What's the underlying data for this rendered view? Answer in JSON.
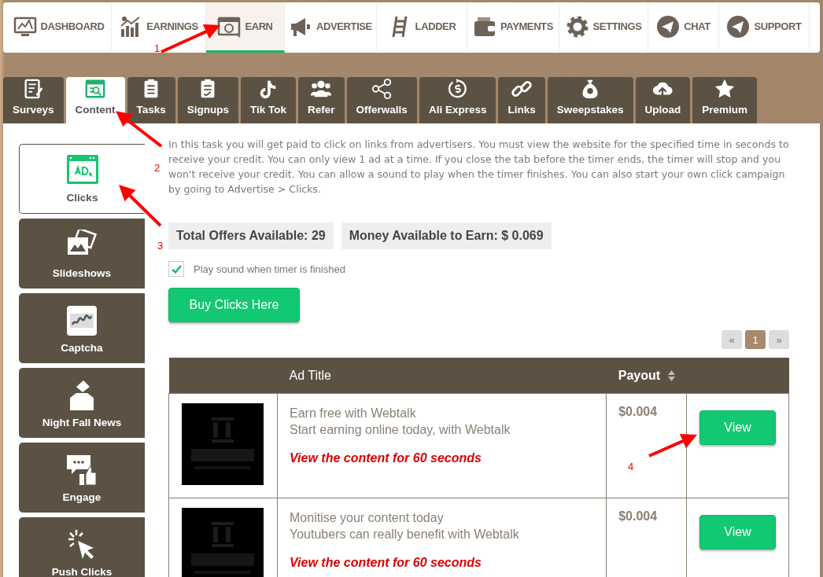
{
  "nav": [
    {
      "label": "DASHBOARD",
      "kind": "dashboard",
      "selected": false
    },
    {
      "label": "EARNINGS",
      "kind": "earnings",
      "selected": false
    },
    {
      "label": "EARN",
      "kind": "earn",
      "selected": true
    },
    {
      "label": "ADVERTISE",
      "kind": "advertise",
      "selected": false
    },
    {
      "label": "LADDER",
      "kind": "ladder",
      "selected": false
    },
    {
      "label": "PAYMENTS",
      "kind": "payments",
      "selected": false
    },
    {
      "label": "SETTINGS",
      "kind": "settings",
      "selected": false
    },
    {
      "label": "CHAT",
      "kind": "chat",
      "selected": false
    },
    {
      "label": "SUPPORT",
      "kind": "support",
      "selected": false
    }
  ],
  "tabs": [
    {
      "label": "Surveys",
      "kind": "surveys",
      "selected": false
    },
    {
      "label": "Content",
      "kind": "content",
      "selected": true
    },
    {
      "label": "Tasks",
      "kind": "tasks",
      "selected": false
    },
    {
      "label": "Signups",
      "kind": "signups",
      "selected": false
    },
    {
      "label": "Tik Tok",
      "kind": "tiktok",
      "selected": false
    },
    {
      "label": "Refer",
      "kind": "refer",
      "selected": false
    },
    {
      "label": "Offerwalls",
      "kind": "offerwalls",
      "selected": false
    },
    {
      "label": "Ali Express",
      "kind": "aliexpress",
      "selected": false
    },
    {
      "label": "Links",
      "kind": "links",
      "selected": false
    },
    {
      "label": "Sweepstakes",
      "kind": "sweepstakes",
      "selected": false
    },
    {
      "label": "Upload",
      "kind": "upload",
      "selected": false
    },
    {
      "label": "Premium",
      "kind": "premium",
      "selected": false
    }
  ],
  "sidebar": {
    "items": [
      {
        "label": "Clicks",
        "kind": "clicks",
        "selected": true
      },
      {
        "label": "Slideshows",
        "kind": "slideshows",
        "selected": false
      },
      {
        "label": "Captcha",
        "kind": "captcha",
        "selected": false
      },
      {
        "label": "Night Fall News",
        "kind": "news",
        "selected": false
      },
      {
        "label": "Engage",
        "kind": "engage",
        "selected": false
      },
      {
        "label": "Push Clicks",
        "kind": "push",
        "selected": false
      }
    ]
  },
  "intro": "In this task you will get paid to click on links from advertisers. You must view the website for the specified time in seconds to receive your credit. You can only view 1 ad at a time. If you close the tab before the timer ends, the timer will stop and you won't receive your credit. You can allow a sound to play when the timer finishes. You can also start your own click campaign by going to Advertise > Clicks.",
  "stats": [
    "Total Offers Available: 29",
    "Money Available to Earn: $ 0.069"
  ],
  "sound_option": {
    "label": "Play sound when timer is finished",
    "checked": true
  },
  "buy_button": "Buy Clicks Here",
  "pagination": [
    {
      "label": "«",
      "selected": false
    },
    {
      "label": "1",
      "selected": true
    },
    {
      "label": "»",
      "selected": false
    }
  ],
  "table": {
    "columns": [
      {
        "label": "Ad Title",
        "sortable": false
      },
      {
        "label": "Payout",
        "sortable": true
      }
    ],
    "rows": [
      {
        "title": "Earn free with Webtalk",
        "description": "Start earning online today, with Webtalk",
        "note": "View the content for 60 seconds",
        "payout": "$0.004",
        "action": "View"
      },
      {
        "title": "Monitise your content today",
        "description": "Youtubers can really benefit with Webtalk",
        "note": "View the content for 60 seconds",
        "payout": "$0.004",
        "action": "View"
      }
    ]
  },
  "annotations": [
    {
      "label": "1"
    },
    {
      "label": "2"
    },
    {
      "label": "3"
    },
    {
      "label": "4"
    }
  ]
}
